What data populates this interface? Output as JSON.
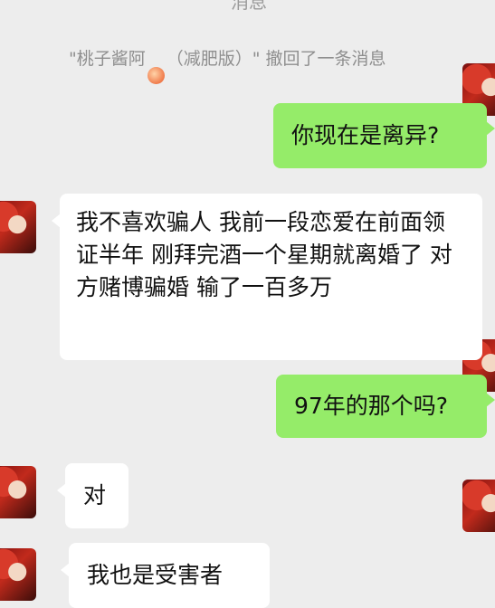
{
  "header": {
    "partial_title": "消息"
  },
  "system_notice": {
    "prefix": "\"桃子酱阿",
    "emoji": "🍑",
    "suffix": "（减肥版）\" 撤回了一条消息"
  },
  "messages": [
    {
      "side": "right",
      "text": "你现在是离异?"
    },
    {
      "side": "left",
      "text": "我不喜欢骗人 我前一段恋爱在前面领证半年 刚拜完酒一个星期就离婚了 对方赌博骗婚 输了一百多万"
    },
    {
      "side": "right",
      "text": "97年的那个吗?"
    },
    {
      "side": "left",
      "text": "对"
    },
    {
      "side": "left",
      "text": "我也是受害者"
    }
  ],
  "colors": {
    "background": "#ededed",
    "self_bubble": "#95ec69",
    "other_bubble": "#ffffff"
  }
}
